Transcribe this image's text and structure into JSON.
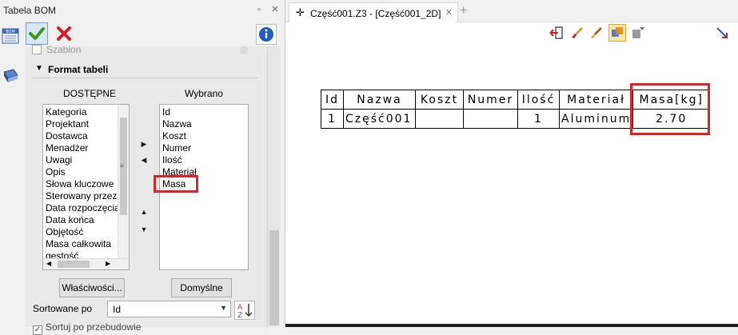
{
  "panel": {
    "title": "Tabela BOM",
    "pin_icon": "pin-icon",
    "close_icon": "close-icon",
    "bom_icon_label": "BOM"
  },
  "template": {
    "label": "Szablon"
  },
  "format": {
    "title": "Format tabeli",
    "available_header": "DOSTĘPNE",
    "selected_header": "Wybrano",
    "available_items": [
      "Kategoria",
      "Projektant",
      "Dostawca",
      "Menadżer",
      "Uwagi",
      "Opis",
      "Słowa kluczowe",
      "Sterowany przez",
      "Data rozpoczęcia",
      "Data końca",
      "Objętość",
      "Masa całkowita",
      "gęstość"
    ],
    "selected_items": [
      "Id",
      "Nazwa",
      "Koszt",
      "Numer",
      "Ilość",
      "Materiał",
      "Masa"
    ],
    "properties_button": "Właściwości...",
    "default_button": "Domyślne"
  },
  "sort": {
    "label": "Sortowane po",
    "value": "Id",
    "bottom_option": "Sortuj po przebudowie"
  },
  "document_tab": {
    "label": "Część001.Z3 - [Część001_2D]",
    "add": "+"
  },
  "bom_table": {
    "headers": [
      "Id",
      "Nazwa",
      "Koszt",
      "Numer",
      "Ilość",
      "Materiał",
      "Masa[kg]"
    ],
    "rows": [
      [
        "1",
        "Część001",
        "",
        "",
        "1",
        "Aluminum",
        "2.70"
      ]
    ]
  },
  "colors": {
    "highlight": "#e0232a",
    "ok_green": "#3a9a1c",
    "cancel_red": "#d21f1f",
    "info_blue": "#1f5fbf"
  }
}
